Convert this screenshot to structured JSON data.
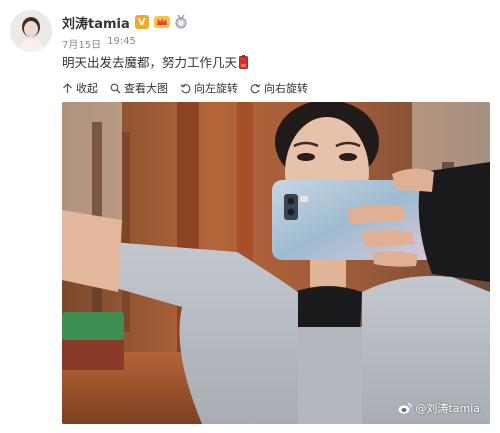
{
  "post": {
    "username": "刘涛tamia",
    "badge_v": "V",
    "date": "7月15日",
    "time": "19:45",
    "text": "明天出发去魔都，努力工作几天"
  },
  "toolbar": {
    "collapse_label": "收起",
    "view_large_label": "查看大图",
    "rotate_left_label": "向左旋转",
    "rotate_right_label": "向右旋转"
  },
  "photo": {
    "watermark": "@刘涛tamia"
  },
  "icons": {
    "collapse": "arrow-up-icon",
    "view_large": "magnifier-icon",
    "rotate_left": "rotate-left-icon",
    "rotate_right": "rotate-right-icon",
    "verified": "verified-v-icon",
    "crown": "crown-icon",
    "medal": "medal-icon",
    "battery": "battery-emoji-icon",
    "weibo": "weibo-logo-icon"
  },
  "colors": {
    "accent": "#f5a623",
    "meta_text": "#8a8a8a",
    "shirt": "#b9bec4",
    "phone": "#a9c4d6"
  }
}
